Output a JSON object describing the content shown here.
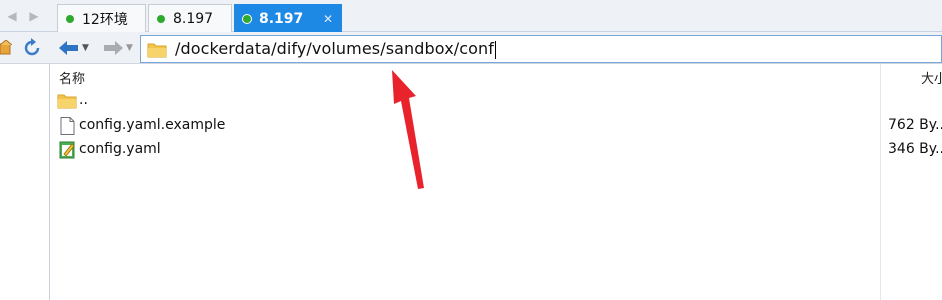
{
  "tabs": [
    {
      "label": "12环境",
      "dot_color": "#2eaa2e",
      "active": false
    },
    {
      "label": "8.197",
      "dot_color": "#2eaa2e",
      "active": false
    },
    {
      "label": "8.197",
      "dot_color": "#2eaa2e",
      "active": true
    }
  ],
  "tab_close_glyph": "✕",
  "toolbar": {
    "back_icon": "back-arrow-icon",
    "forward_icon": "forward-arrow-icon",
    "dropdown_icon": "chevron-down-icon"
  },
  "address_bar": {
    "path": "/dockerdata/dify/volumes/sandbox/conf",
    "folder_icon": "folder-icon"
  },
  "file_list": {
    "columns": {
      "name": "名称",
      "size": "大小"
    },
    "rows": [
      {
        "name": "..",
        "size": "",
        "icon": "folder-icon"
      },
      {
        "name": "config.yaml.example",
        "size": "762 By...",
        "icon": "document-icon"
      },
      {
        "name": "config.yaml",
        "size": "346 By...",
        "icon": "edit-file-icon"
      }
    ]
  },
  "colors": {
    "accent": "#1e88e5",
    "annotation": "#e8232b"
  }
}
